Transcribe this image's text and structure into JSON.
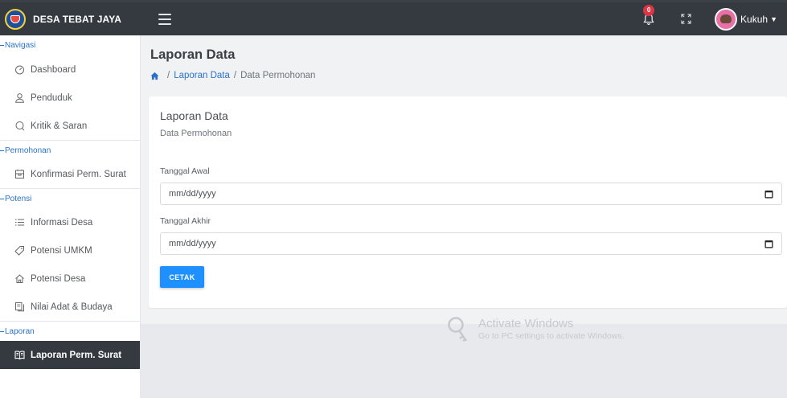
{
  "brand": {
    "name": "DESA TEBAT JAYA"
  },
  "navbar": {
    "notification_count": "0",
    "user_name": "Kukuh"
  },
  "sidebar": {
    "sections": [
      {
        "label": "Navigasi",
        "items": [
          {
            "label": "Dashboard",
            "icon": "dashboard-icon"
          },
          {
            "label": "Penduduk",
            "icon": "user-icon"
          },
          {
            "label": "Kritik & Saran",
            "icon": "comment-icon"
          }
        ]
      },
      {
        "label": "Permohonan",
        "items": [
          {
            "label": "Konfirmasi Perm. Surat",
            "icon": "inbox-icon"
          }
        ]
      },
      {
        "label": "Potensi",
        "items": [
          {
            "label": "Informasi Desa",
            "icon": "list-icon"
          },
          {
            "label": "Potensi UMKM",
            "icon": "tag-icon"
          },
          {
            "label": "Potensi Desa",
            "icon": "home-icon"
          },
          {
            "label": "Nilai Adat & Budaya",
            "icon": "copy-icon"
          }
        ]
      },
      {
        "label": "Laporan",
        "items": [
          {
            "label": "Laporan Perm. Surat",
            "icon": "book-icon",
            "active": true
          }
        ]
      }
    ]
  },
  "page": {
    "title": "Laporan Data",
    "breadcrumb": {
      "link": "Laporan Data",
      "current": "Data Permohonan"
    }
  },
  "card": {
    "title": "Laporan Data",
    "subtitle": "Data Permohonan",
    "start_label": "Tanggal Awal",
    "start_value": "mm/dd/yyyy",
    "end_label": "Tanggal Akhir",
    "end_value": "mm/dd/yyyy",
    "print_label": "CETAK"
  },
  "watermark": {
    "title": "Activate Windows",
    "subtitle": "Go to PC settings to activate Windows."
  },
  "colors": {
    "navbar": "#343a40",
    "accent": "#2a72c9",
    "button": "#1e90ff",
    "badge": "#dc3545"
  }
}
